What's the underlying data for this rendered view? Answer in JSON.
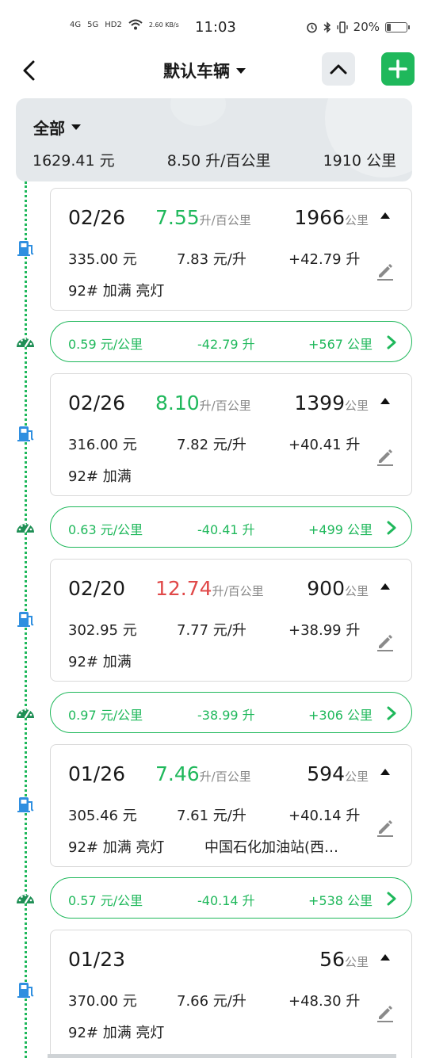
{
  "status_bar": {
    "net1": "4G",
    "net2": "5G",
    "hd": "HD2",
    "speed": "2.60 KB/s",
    "time": "11:03",
    "battery": "20%",
    "battery_level": 0.2
  },
  "nav": {
    "title": "默认车辆"
  },
  "summary": {
    "filter": "全部",
    "total_cost": "1629.41 元",
    "avg_consumption": "8.50 升/百公里",
    "total_distance": "1910 公里"
  },
  "records": [
    {
      "date": "02/26",
      "consumption": "7.55",
      "consumption_unit": "升/百公里",
      "consumption_color": "green",
      "odometer": "1966",
      "odometer_unit": "公里",
      "cost": "335.00 元",
      "price": "7.83 元/升",
      "liters": "+42.79 升",
      "note": "92# 加满 亮灯",
      "station": "",
      "segment": {
        "cost_per_km": "0.59 元/公里",
        "liters": "-42.79 升",
        "distance": "+567 公里"
      }
    },
    {
      "date": "02/26",
      "consumption": "8.10",
      "consumption_unit": "升/百公里",
      "consumption_color": "green",
      "odometer": "1399",
      "odometer_unit": "公里",
      "cost": "316.00 元",
      "price": "7.82 元/升",
      "liters": "+40.41 升",
      "note": "92# 加满",
      "station": "",
      "segment": {
        "cost_per_km": "0.63 元/公里",
        "liters": "-40.41 升",
        "distance": "+499 公里"
      }
    },
    {
      "date": "02/20",
      "consumption": "12.74",
      "consumption_unit": "升/百公里",
      "consumption_color": "red",
      "odometer": "900",
      "odometer_unit": "公里",
      "cost": "302.95 元",
      "price": "7.77 元/升",
      "liters": "+38.99 升",
      "note": "92# 加满",
      "station": "",
      "segment": {
        "cost_per_km": "0.97 元/公里",
        "liters": "-38.99 升",
        "distance": "+306 公里"
      }
    },
    {
      "date": "01/26",
      "consumption": "7.46",
      "consumption_unit": "升/百公里",
      "consumption_color": "green",
      "odometer": "594",
      "odometer_unit": "公里",
      "cost": "305.46 元",
      "price": "7.61 元/升",
      "liters": "+40.14 升",
      "note": "92# 加满 亮灯",
      "station": "中国石化加油站(西…",
      "segment": {
        "cost_per_km": "0.57 元/公里",
        "liters": "-40.14 升",
        "distance": "+538 公里"
      }
    },
    {
      "date": "01/23",
      "consumption": "",
      "consumption_unit": "",
      "consumption_color": "green",
      "odometer": "56",
      "odometer_unit": "公里",
      "cost": "370.00 元",
      "price": "7.66 元/升",
      "liters": "+48.30 升",
      "note": "92# 加满 亮灯",
      "station": ""
    }
  ],
  "colors": {
    "accent": "#1fb85b",
    "warning": "#e04848",
    "fuel_icon": "#2f8fe0"
  },
  "icons": {
    "back": "chevron-left-icon",
    "dropdown": "caret-down-icon",
    "collapse": "chevron-up-icon",
    "add": "plus-icon",
    "fuel": "fuel-pump-icon",
    "gauge": "speedometer-icon",
    "edit": "pencil-icon",
    "chevron": "chevron-right-icon"
  }
}
